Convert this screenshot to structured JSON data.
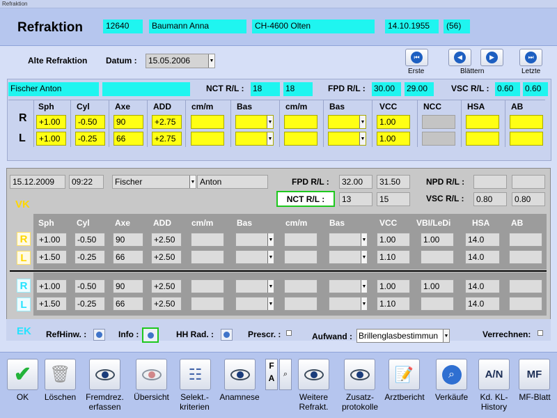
{
  "window": {
    "title": "Refraktion"
  },
  "header": {
    "title": "Refraktion",
    "patient_id": "12640",
    "patient_name": "Baumann Anna",
    "city": "CH-4600 Olten",
    "dob": "14.10.1955",
    "age": "(56)"
  },
  "old": {
    "label": "Alte Refraktion",
    "date_label": "Datum :",
    "date_value": "15.05.2006",
    "nav": {
      "first": "Erste",
      "browse": "Blättern",
      "last": "Letzte"
    }
  },
  "panel1": {
    "doctor": "Fischer Anton",
    "doctor2": "",
    "nct_label": "NCT R/L :",
    "nct_r": "18",
    "nct_l": "18",
    "fpd_label": "FPD R/L :",
    "fpd_r": "30.00",
    "fpd_l": "29.00",
    "vsc_label": "VSC R/L :",
    "vsc_r": "0.60",
    "vsc_l": "0.60",
    "columns": [
      "Sph",
      "Cyl",
      "Axe",
      "ADD",
      "cm/m",
      "Bas",
      "cm/m",
      "Bas",
      "VCC",
      "NCC",
      "HSA",
      "AB"
    ],
    "rows": [
      {
        "eye": "R",
        "sph": "+1.00",
        "cyl": "-0.50",
        "axe": "90",
        "add": "+2.75",
        "vcc": "1.00"
      },
      {
        "eye": "L",
        "sph": "+1.00",
        "cyl": "-0.25",
        "axe": "66",
        "add": "+2.75",
        "vcc": "1.00"
      }
    ]
  },
  "panel2": {
    "date": "15.12.2009",
    "time": "09:22",
    "lastname": "Fischer",
    "firstname": "Anton",
    "vk": "VK",
    "ek": "EK",
    "fpd_label": "FPD R/L :",
    "fpd_r": "32.00",
    "fpd_l": "31.50",
    "npd_label": "NPD R/L :",
    "npd_r": "",
    "npd_l": "",
    "nct_button": "NCT R/L :",
    "nct_r": "13",
    "nct_l": "15",
    "vsc_label": "VSC R/L :",
    "vsc_r": "0.80",
    "vsc_l": "0.80",
    "columns": [
      "Sph",
      "Cyl",
      "Axe",
      "ADD",
      "cm/m",
      "Bas",
      "cm/m",
      "Bas",
      "VCC",
      "VBI/LeDi",
      "HSA",
      "AB"
    ],
    "vk_rows": [
      {
        "eye": "R",
        "sph": "+1.00",
        "cyl": "-0.50",
        "axe": "90",
        "add": "+2.50",
        "vcc": "1.00",
        "vbi": "1.00",
        "hsa": "14.0"
      },
      {
        "eye": "L",
        "sph": "+1.50",
        "cyl": "-0.25",
        "axe": "66",
        "add": "+2.50",
        "vcc": "1.10",
        "vbi": "",
        "hsa": "14.0"
      }
    ],
    "ek_rows": [
      {
        "eye": "R",
        "sph": "+1.00",
        "cyl": "-0.50",
        "axe": "90",
        "add": "+2.50",
        "vcc": "1.00",
        "vbi": "1.00",
        "hsa": "14.0"
      },
      {
        "eye": "L",
        "sph": "+1.50",
        "cyl": "-0.25",
        "axe": "66",
        "add": "+2.50",
        "vcc": "1.10",
        "vbi": "",
        "hsa": "14.0"
      }
    ],
    "bottom": {
      "refhinw": "RefHinw. :",
      "info": "Info :",
      "hhrad": "HH Rad. :",
      "prescr": "Prescr. :",
      "aufwand": "Aufwand :",
      "aufwand_value": "Brillenglasbestimmun",
      "verrechnen": "Verrechnen:"
    }
  },
  "toolbar": {
    "ok": "OK",
    "delete": "Löschen",
    "fremd": [
      "Fremdrez.",
      "erfassen"
    ],
    "overview": "Übersicht",
    "select": [
      "Selekt.-",
      "kriterien"
    ],
    "anamnese": "Anamnese",
    "fa_f": "F",
    "fa_a": "A",
    "weitere": [
      "Weitere",
      "Refrakt."
    ],
    "zusatz": [
      "Zusatz-",
      "protokolle"
    ],
    "arztbericht": "Arztbericht",
    "verkaufe": "Verkäufe",
    "an": "A/N",
    "kdkl": [
      "Kd. KL-",
      "History"
    ],
    "mf": "MF",
    "mfblatt": "MF-Blatt"
  }
}
